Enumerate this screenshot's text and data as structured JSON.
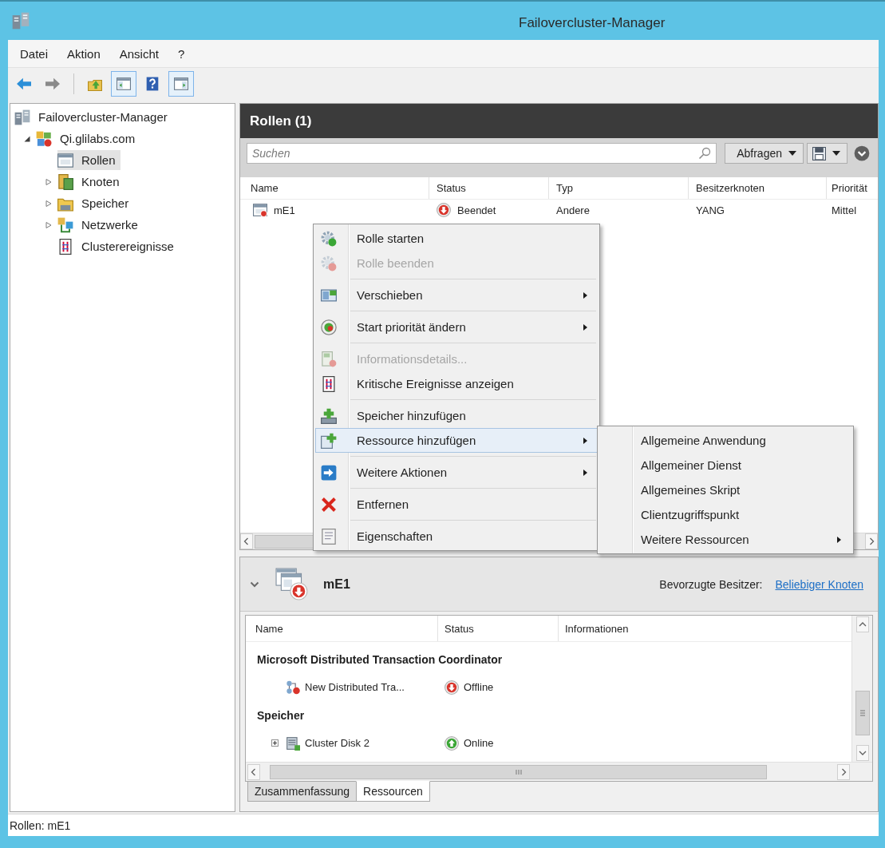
{
  "window": {
    "title": "Failovercluster-Manager"
  },
  "menu_bar": [
    "Datei",
    "Aktion",
    "Ansicht",
    "?"
  ],
  "toolbar": [
    {
      "pressed": false
    },
    {
      "pressed": false
    },
    {
      "pressed": false
    },
    {
      "pressed": true
    },
    {
      "pressed": false
    },
    {
      "pressed": true
    }
  ],
  "tree": [
    {
      "label": "Failovercluster-Manager",
      "selected": false,
      "children": [
        {
          "label": "Qi.glilabs.com",
          "selected": false,
          "expanded": true,
          "children": [
            {
              "label": "Rollen",
              "selected": true
            },
            {
              "label": "Knoten",
              "selected": false,
              "expanded": false
            },
            {
              "label": "Speicher",
              "selected": false,
              "expanded": false
            },
            {
              "label": "Netzwerke",
              "selected": false,
              "expanded": false
            },
            {
              "label": "Clusterereignisse",
              "selected": false
            }
          ]
        }
      ]
    }
  ],
  "roles_pane": {
    "title": "Rollen (1)",
    "search": {
      "placeholder": "Suchen"
    },
    "query_button": "Abfragen",
    "columns": [
      "Name",
      "Status",
      "Typ",
      "Besitzerknoten",
      "Priorität"
    ],
    "rows": [
      {
        "name": "mE1",
        "online": false,
        "status": "Beendet",
        "type": "Andere",
        "owner_node": "YANG",
        "priority": "Mittel"
      }
    ]
  },
  "context_menu": {
    "groups": [
      {
        "items": [
          {
            "label": "Rolle starten",
            "disabled": false,
            "has_submenu": false,
            "selected": false
          },
          {
            "label": "Rolle beenden",
            "disabled": true,
            "has_submenu": false,
            "selected": false
          }
        ]
      },
      {
        "items": [
          {
            "label": "Verschieben",
            "disabled": false,
            "has_submenu": true,
            "selected": false
          }
        ]
      },
      {
        "items": [
          {
            "label": "Start priorität ändern",
            "disabled": false,
            "has_submenu": true,
            "selected": false
          }
        ]
      },
      {
        "items": [
          {
            "label": "Informationsdetails...",
            "disabled": true,
            "has_submenu": false,
            "selected": false
          },
          {
            "label": "Kritische Ereignisse anzeigen",
            "disabled": false,
            "has_submenu": false,
            "selected": false
          }
        ]
      },
      {
        "items": [
          {
            "label": "Speicher hinzufügen",
            "disabled": false,
            "has_submenu": false,
            "selected": false
          },
          {
            "label": "Ressource hinzufügen",
            "disabled": false,
            "has_submenu": true,
            "selected": true
          }
        ]
      },
      {
        "items": [
          {
            "label": "Weitere Aktionen",
            "disabled": false,
            "has_submenu": true,
            "selected": false
          }
        ]
      },
      {
        "items": [
          {
            "label": "Entfernen",
            "disabled": false,
            "has_submenu": false,
            "selected": false
          }
        ]
      },
      {
        "items": [
          {
            "label": "Eigenschaften",
            "disabled": false,
            "has_submenu": false,
            "selected": false
          }
        ]
      }
    ]
  },
  "submenu": {
    "items": [
      {
        "label": "Allgemeine Anwendung",
        "has_submenu": false,
        "selected": false
      },
      {
        "label": "Allgemeiner Dienst",
        "has_submenu": false,
        "selected": false
      },
      {
        "label": "Allgemeines Skript",
        "has_submenu": false,
        "selected": false
      },
      {
        "label": "Clientzugriffspunkt",
        "has_submenu": false,
        "selected": false
      },
      {
        "label": "Weitere Ressourcen",
        "has_submenu": true,
        "selected": false
      }
    ]
  },
  "details": {
    "expanded": true,
    "title": "mE1",
    "online": false,
    "preferred_owners_label": "Bevorzugte Besitzer:",
    "preferred_owners_link": "Beliebiger Knoten",
    "columns": [
      "Name",
      "Status",
      "Informationen"
    ],
    "groups": [
      {
        "title": "Microsoft Distributed Transaction Coordinator",
        "items": [
          {
            "name": "New Distributed Tra...",
            "online": false,
            "status": "Offline"
          }
        ]
      },
      {
        "title": "Speicher",
        "items": [
          {
            "name": "Cluster Disk 2",
            "expanded": false,
            "online": true,
            "status": "Online"
          }
        ]
      }
    ],
    "tabs": [
      {
        "label": "Zusammenfassung",
        "selected": false
      },
      {
        "label": "Ressourcen",
        "selected": true
      }
    ]
  },
  "status_bar": "Rollen: mE1"
}
